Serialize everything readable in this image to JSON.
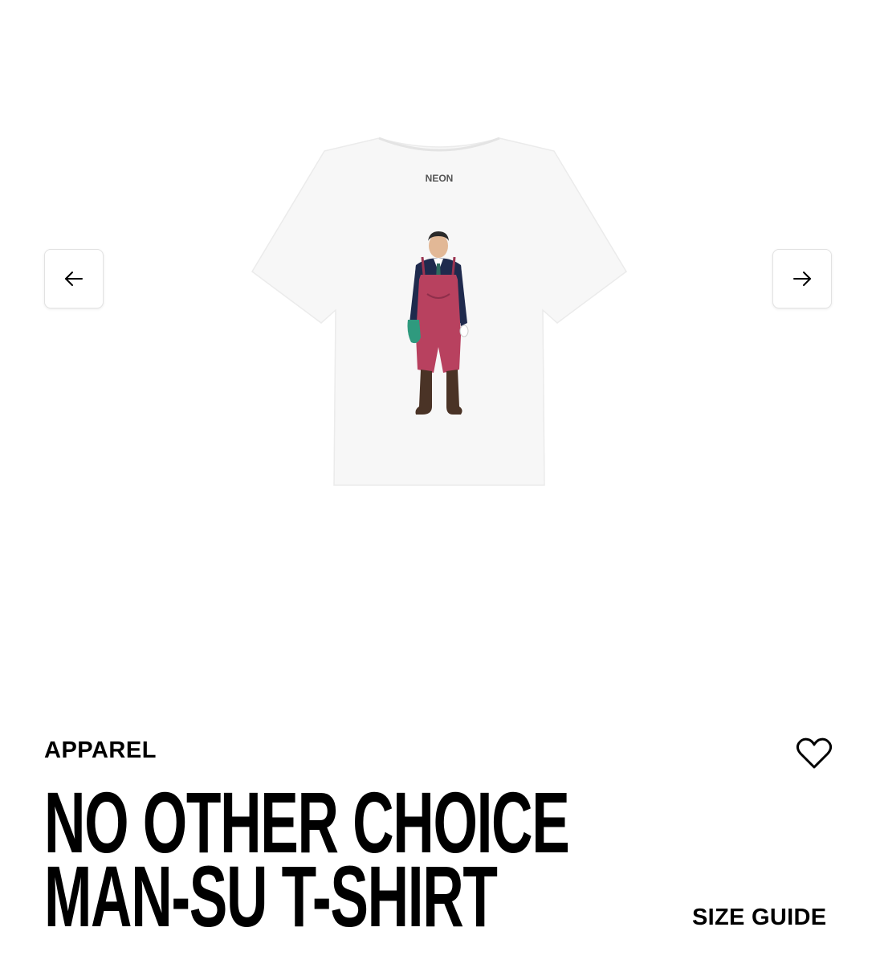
{
  "gallery": {
    "prev_icon": "arrow-left-icon",
    "next_icon": "arrow-right-icon",
    "image": {
      "description_icon": "t-shirt-image",
      "neck_label": "NEON"
    }
  },
  "product": {
    "category": "APPAREL",
    "title_line1": "NO OTHER CHOICE",
    "title_line2": "MAN-SU T-SHIRT",
    "wishlist_icon": "heart-icon",
    "size_guide_label": "SIZE GUIDE"
  },
  "colors": {
    "text": "#000000",
    "shirt": "#f7f7f7",
    "waders": "#b8415f",
    "jacket": "#1f2a4d",
    "glove": "#2f9a7e"
  }
}
